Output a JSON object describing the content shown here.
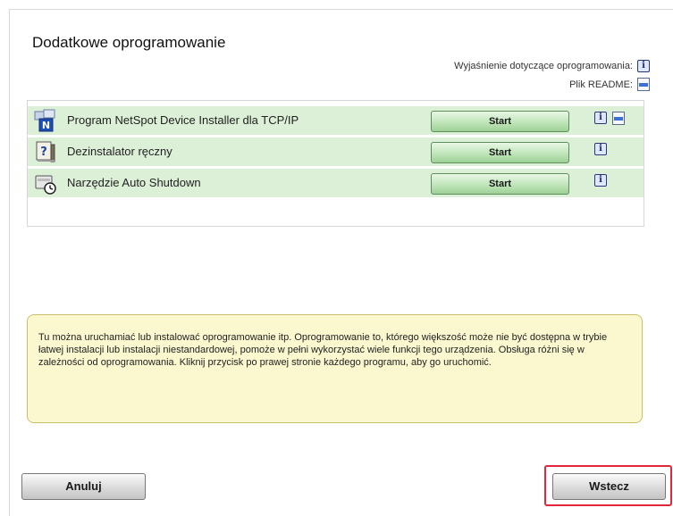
{
  "title": "Dodatkowe oprogramowanie",
  "legend": {
    "info_label": "Wyjaśnienie dotyczące oprogramowania:",
    "info_icon": "info-icon",
    "readme_label": "Plik README:",
    "readme_icon": "readme-icon"
  },
  "programs": [
    {
      "name": "Program NetSpot Device Installer dla TCP/IP",
      "button": "Start",
      "icon": "netspot-installer-icon",
      "has_info": true,
      "has_readme": true
    },
    {
      "name": "Dezinstalator ręczny",
      "button": "Start",
      "icon": "uninstaller-icon",
      "has_info": true,
      "has_readme": false
    },
    {
      "name": "Narzędzie Auto Shutdown",
      "button": "Start",
      "icon": "auto-shutdown-icon",
      "has_info": true,
      "has_readme": false
    }
  ],
  "info_text": "Tu można uruchamiać lub instalować oprogramowanie itp. Oprogramowanie to, którego większość może nie być dostępna w trybie łatwej instalacji lub instalacji niestandardowej, pomoże w pełni wykorzystać wiele funkcji tego urządzenia. Obsługa różni się w zależności od oprogramowania. Kliknij przycisk po prawej stronie każdego programu, aby go uruchomić.",
  "buttons": {
    "cancel": "Anuluj",
    "back": "Wstecz"
  },
  "colors": {
    "row_bg": "#dcefd7",
    "start_button": "#bfe5b9",
    "info_box_bg": "#fbf8cf",
    "highlight": "#e0283a"
  }
}
